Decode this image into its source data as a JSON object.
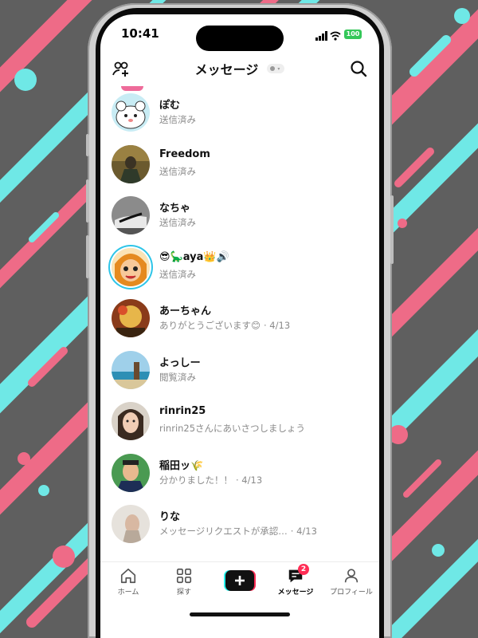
{
  "status_bar": {
    "time": "10:41",
    "battery": "100"
  },
  "header": {
    "title": "メッセージ",
    "status_caret": "▾"
  },
  "conversations": [
    {
      "name": "ぽむ",
      "preview": "送信済み",
      "date": ""
    },
    {
      "name": "Freedom",
      "preview": "送信済み",
      "date": ""
    },
    {
      "name": "なちゃ",
      "preview": "送信済み",
      "date": ""
    },
    {
      "name": "😎🦕aya👑🔊",
      "preview": "送信済み",
      "date": ""
    },
    {
      "name": "あーちゃん",
      "preview": "ありがとうございます😊",
      "date": "· 4/13"
    },
    {
      "name": "よっしー",
      "preview": "閲覧済み",
      "date": ""
    },
    {
      "name": "rinrin25",
      "preview": "rinrin25さんにあいさつしましょう",
      "date": ""
    },
    {
      "name": "稲田ッ🌾",
      "preview": "分かりました！！",
      "date": "· 4/13"
    },
    {
      "name": "りな",
      "preview": "メッセージリクエストが承認…",
      "date": "· 4/13"
    }
  ],
  "tabs": [
    {
      "label": "ホーム",
      "icon": "home-icon"
    },
    {
      "label": "探す",
      "icon": "discover-icon"
    },
    {
      "label": "",
      "icon": "create-plus-icon"
    },
    {
      "label": "メッセージ",
      "icon": "message-icon",
      "badge": "2",
      "active": true
    },
    {
      "label": "プロフィール",
      "icon": "profile-icon"
    }
  ],
  "colors": {
    "pink": "#ee6b87",
    "cyan": "#6fe8e6",
    "background": "#5f5f5f",
    "badge": "#ff2d55"
  }
}
